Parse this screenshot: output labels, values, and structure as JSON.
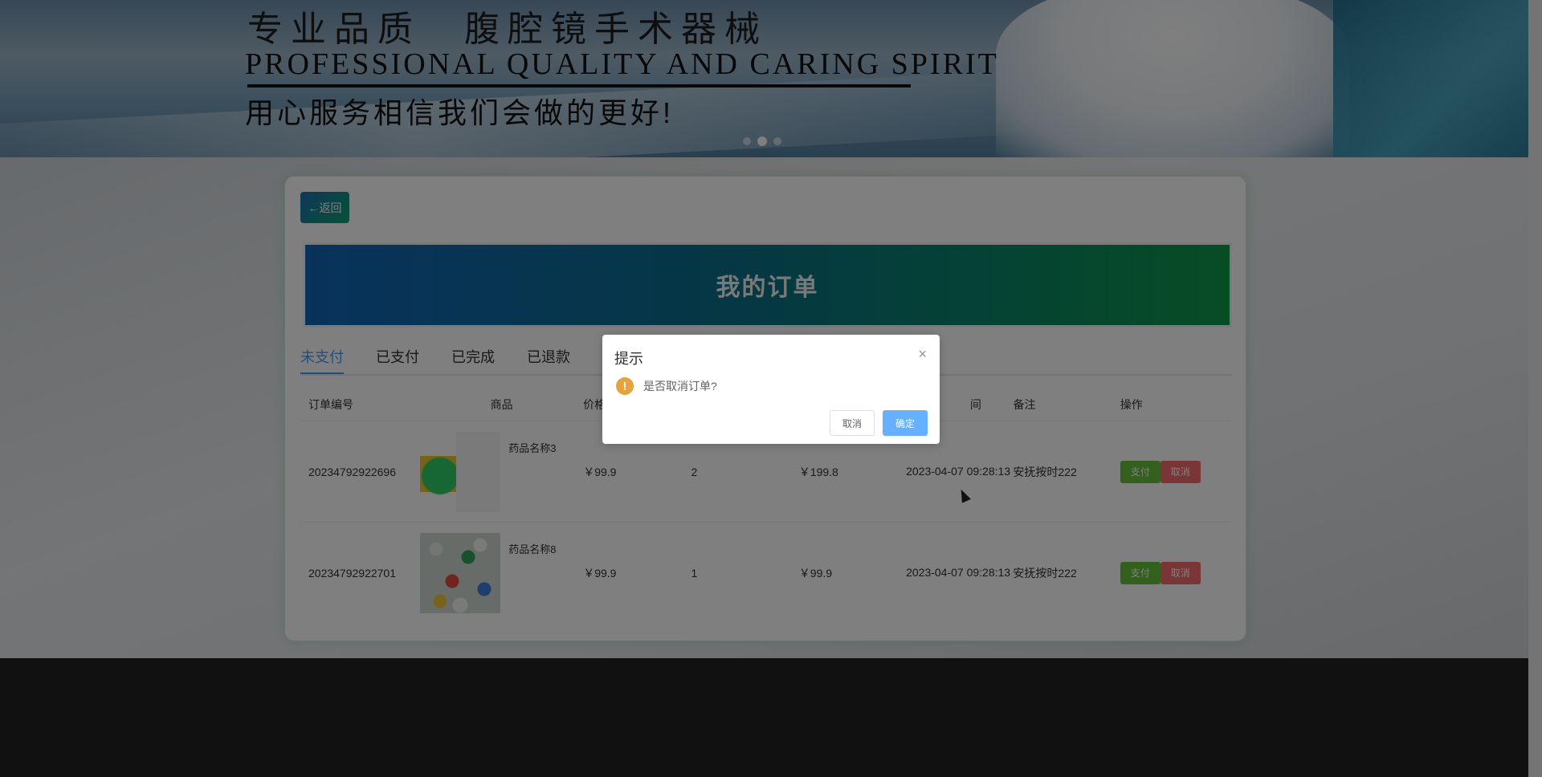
{
  "banner": {
    "title_cn": "专业品质　腹腔镜手术器械",
    "title_en": "PROFESSIONAL QUALITY AND CARING SPIRIT",
    "slogan": "用心服务相信我们会做的更好!"
  },
  "back_label": "←返回",
  "page_title": "我的订单",
  "tabs": [
    {
      "label": "未支付",
      "active": true
    },
    {
      "label": "已支付"
    },
    {
      "label": "已完成"
    },
    {
      "label": "已退款"
    }
  ],
  "table": {
    "headers": {
      "id": "订单编号",
      "goods": "商品",
      "price": "价格",
      "qty": "",
      "total": "",
      "time": "间",
      "remark": "备注",
      "ops": "操作"
    },
    "rows": [
      {
        "id": "20234792922696",
        "name": "药品名称3",
        "price": "￥99.9",
        "qty": "2",
        "total": "￥199.8",
        "time": "2023-04-07 09:28:13",
        "remark": "安抚按时222",
        "pay": "支付",
        "cancel": "取消"
      },
      {
        "id": "20234792922701",
        "name": "药品名称8",
        "price": "￥99.9",
        "qty": "1",
        "total": "￥99.9",
        "time": "2023-04-07 09:28:13",
        "remark": "安抚按时222",
        "pay": "支付",
        "cancel": "取消"
      }
    ]
  },
  "dialog": {
    "title": "提示",
    "close": "×",
    "icon": "!",
    "message": "是否取消订单?",
    "cancel": "取消",
    "confirm": "确定"
  },
  "colors": {
    "accent": "#409eff",
    "success": "#67c23a",
    "danger": "#f56c6c",
    "warning": "#e6a23c"
  }
}
